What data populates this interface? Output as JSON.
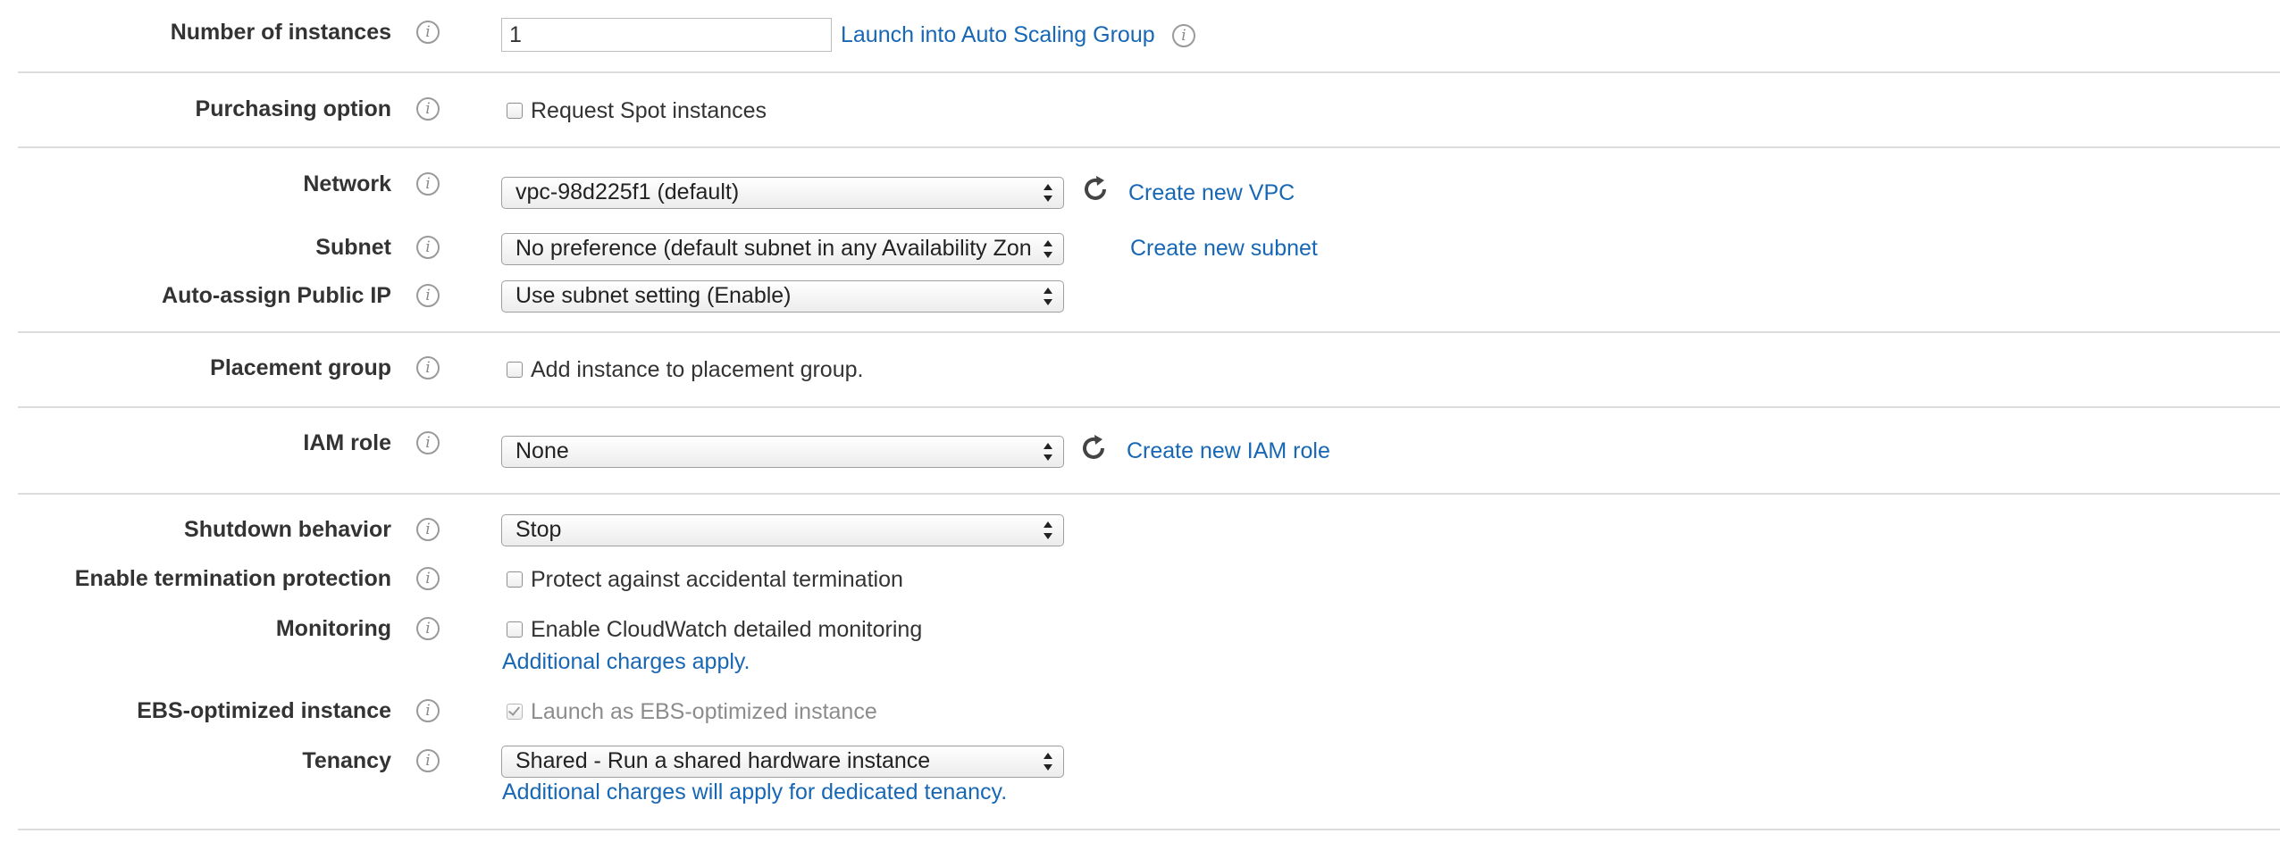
{
  "colors": {
    "link": "#1767b5",
    "label": "#333333",
    "divider": "#dcdcdc",
    "disabled_text": "#8c8c8c"
  },
  "number_of_instances": {
    "label": "Number of instances",
    "value": "1",
    "link": "Launch into Auto Scaling Group",
    "info_icon": "info-icon"
  },
  "purchasing_option": {
    "label": "Purchasing option",
    "checkbox_label": "Request Spot instances",
    "checked": false
  },
  "network": {
    "label": "Network",
    "value": "vpc-98d225f1 (default)",
    "link": "Create new VPC",
    "refresh_icon": "refresh-icon"
  },
  "subnet": {
    "label": "Subnet",
    "value": "No preference (default subnet in any Availability Zon",
    "link": "Create new subnet"
  },
  "auto_assign_ip": {
    "label": "Auto-assign Public IP",
    "value": "Use subnet setting (Enable)"
  },
  "placement_group": {
    "label": "Placement group",
    "checkbox_label": "Add instance to placement group.",
    "checked": false
  },
  "iam_role": {
    "label": "IAM role",
    "value": "None",
    "link": "Create new IAM role",
    "refresh_icon": "refresh-icon"
  },
  "shutdown_behavior": {
    "label": "Shutdown behavior",
    "value": "Stop"
  },
  "termination_protection": {
    "label": "Enable termination protection",
    "checkbox_label": "Protect against accidental termination",
    "checked": false
  },
  "monitoring": {
    "label": "Monitoring",
    "checkbox_label": "Enable CloudWatch detailed monitoring",
    "checked": false,
    "link": "Additional charges apply."
  },
  "ebs_optimized": {
    "label": "EBS-optimized instance",
    "checkbox_label": "Launch as EBS-optimized instance",
    "checked": true,
    "disabled": true
  },
  "tenancy": {
    "label": "Tenancy",
    "value": "Shared - Run a shared hardware instance",
    "link": "Additional charges will apply for dedicated tenancy."
  }
}
